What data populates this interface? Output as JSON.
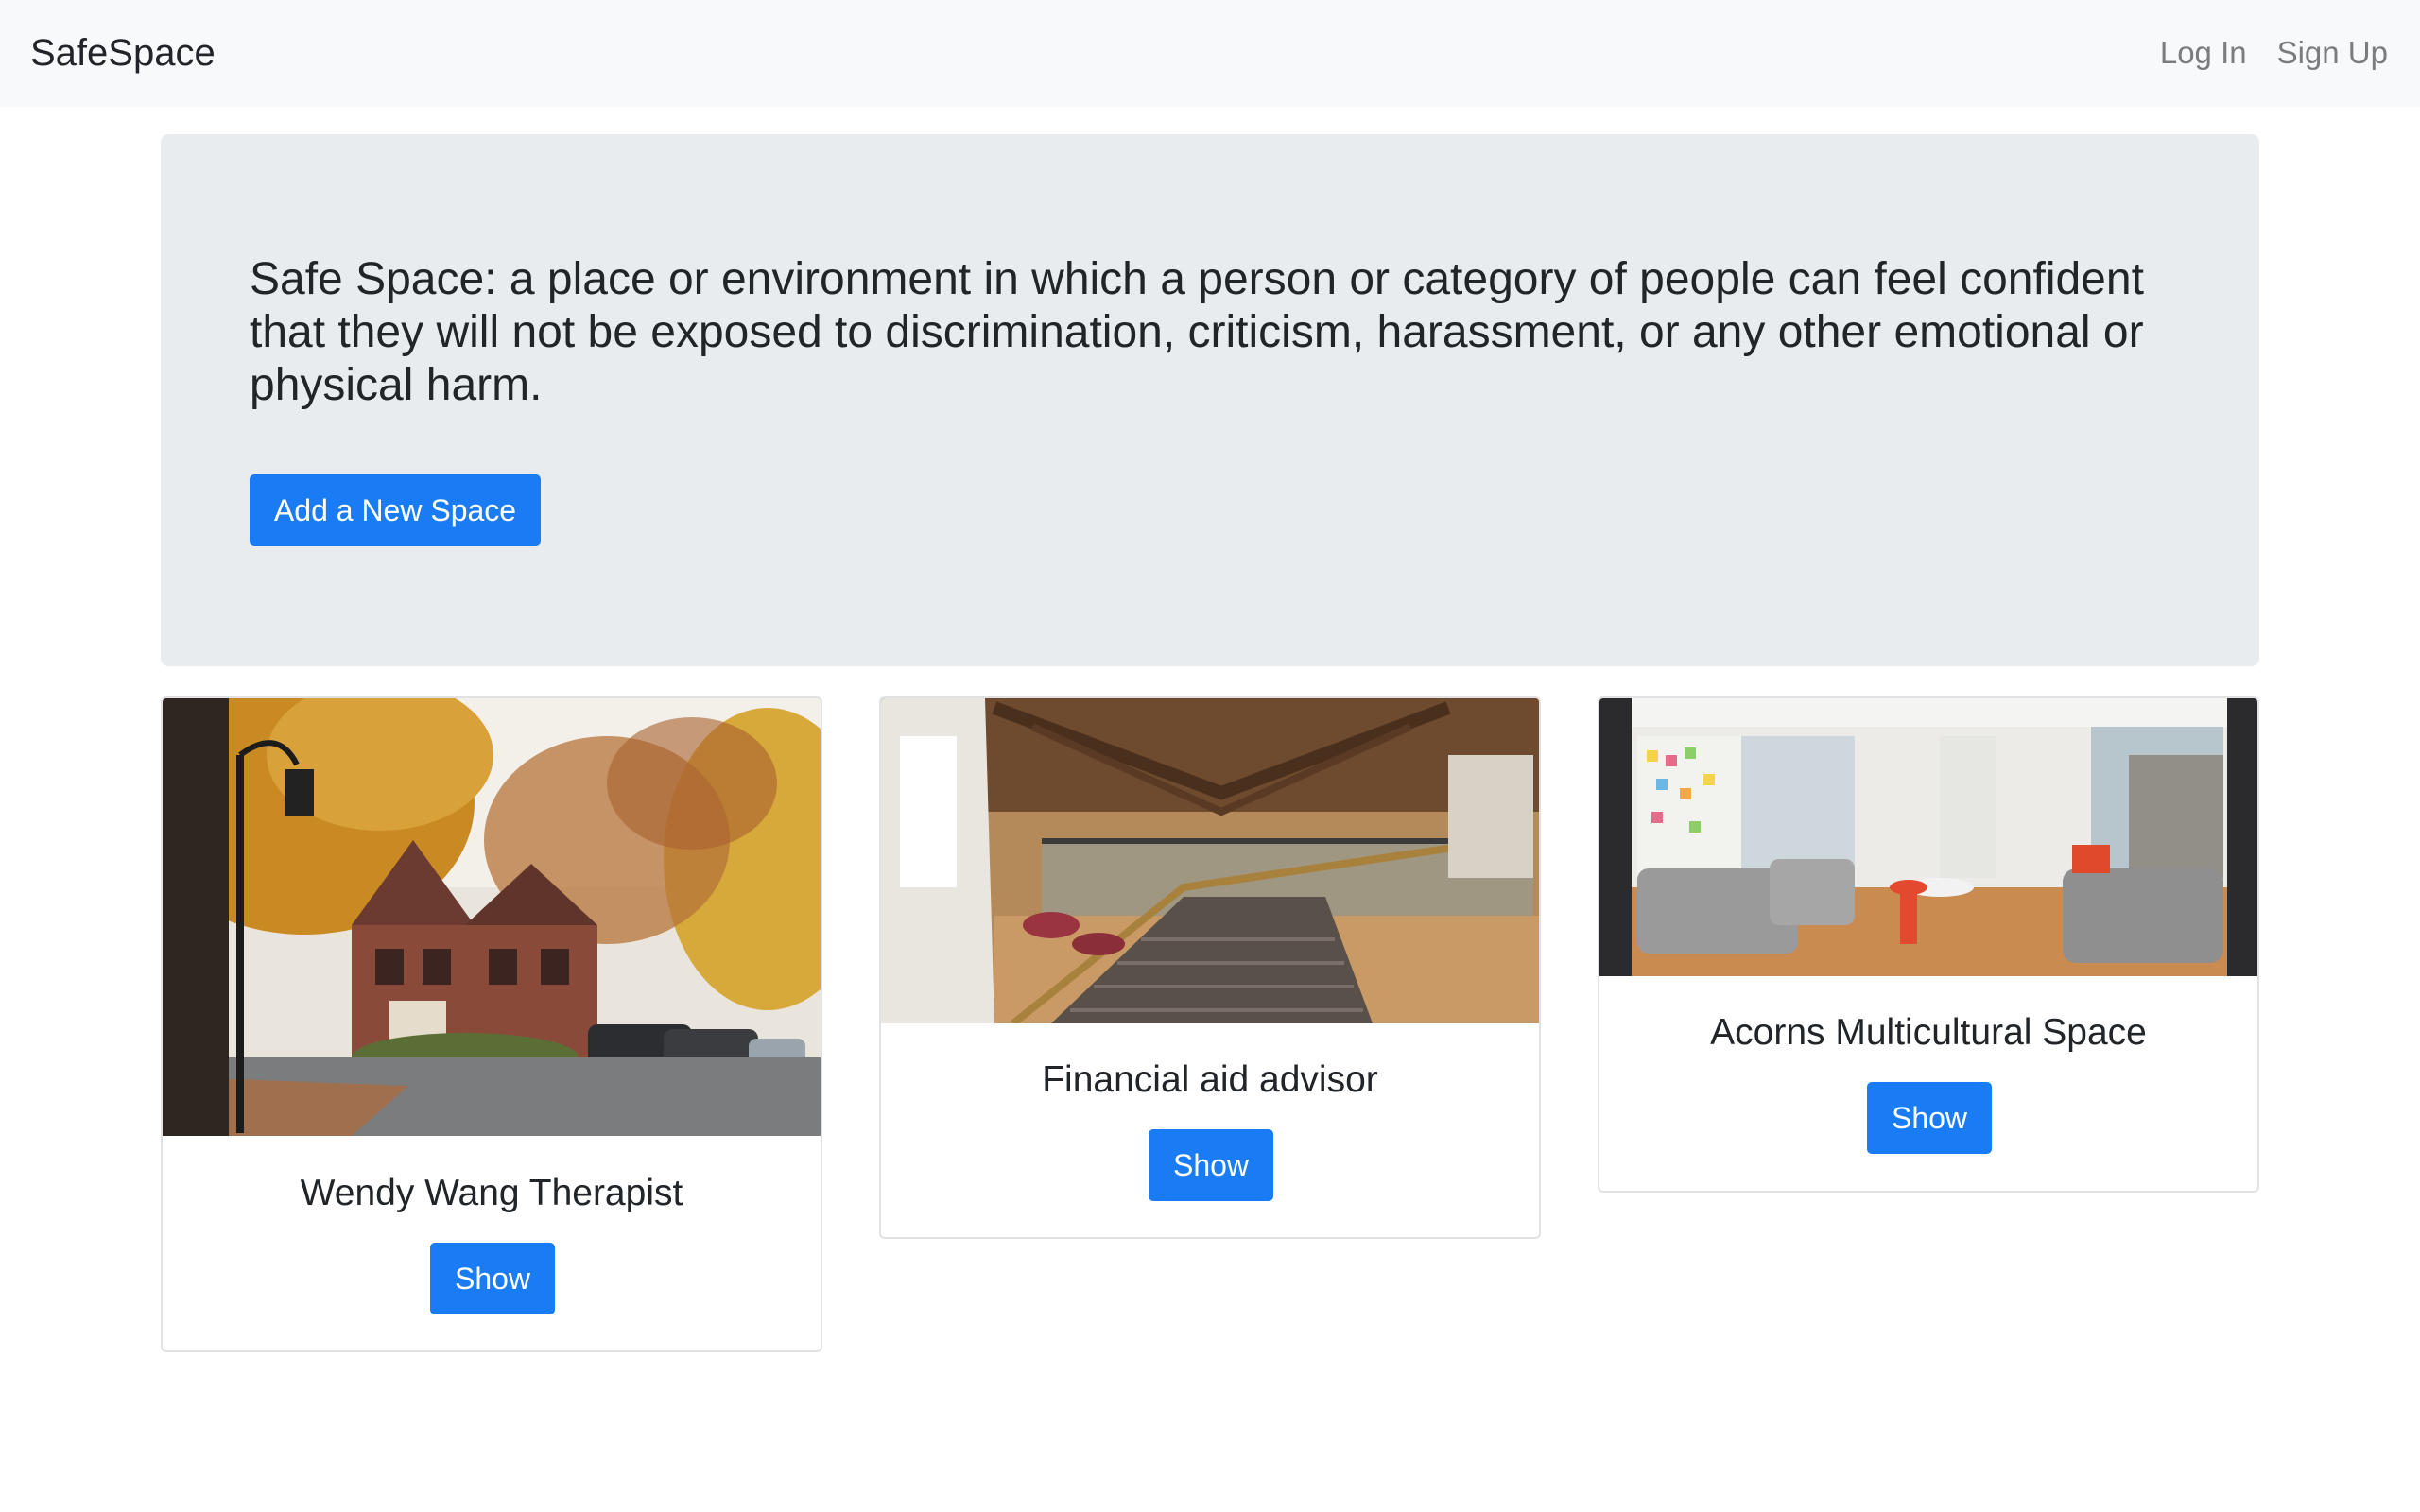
{
  "navbar": {
    "brand": "SafeSpace",
    "login_label": "Log In",
    "signup_label": "Sign Up"
  },
  "hero": {
    "lead": "Safe Space: a place or environment in which a person or category of people can feel confident that they will not be exposed to discrimination, criticism, harassment, or any other emotional or physical harm.",
    "add_button_label": "Add a New Space"
  },
  "cards": [
    {
      "title": "Wendy Wang Therapist",
      "button_label": "Show"
    },
    {
      "title": "Financial aid advisor",
      "button_label": "Show"
    },
    {
      "title": "Acorns Multicultural Space",
      "button_label": "Show"
    }
  ],
  "colors": {
    "primary": "#1a7cf5",
    "navbar_bg": "#f8f9fa",
    "jumbotron_bg": "#e9ecef"
  }
}
